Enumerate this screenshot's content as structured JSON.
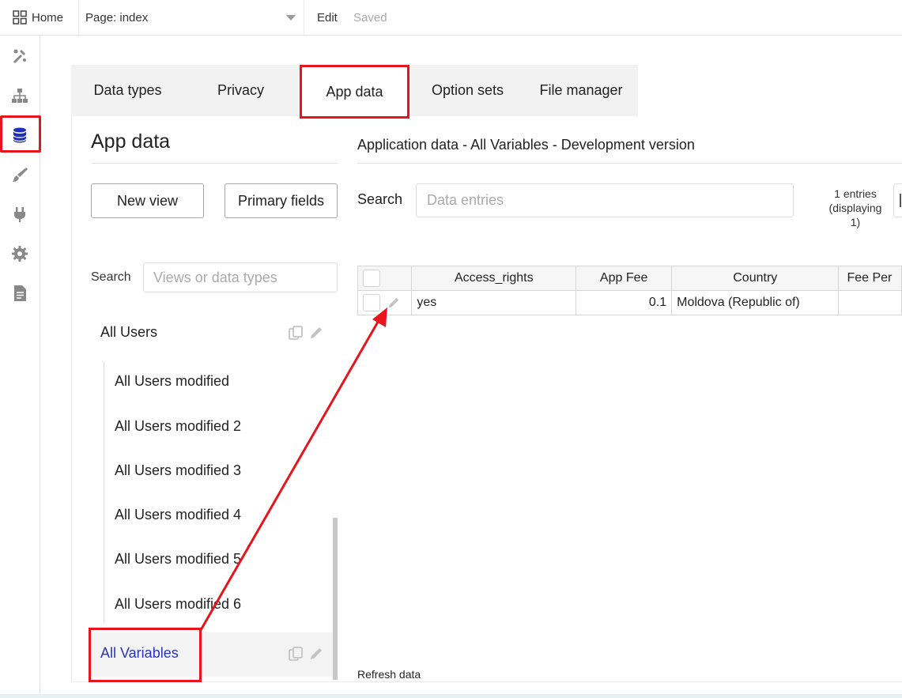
{
  "topbar": {
    "home_label": "Home",
    "page_select": "Page: index",
    "edit_label": "Edit",
    "saved_label": "Saved"
  },
  "rail": {
    "icons": [
      "design-icon",
      "workflow-icon",
      "data-icon",
      "styles-icon",
      "plugins-icon",
      "settings-icon",
      "logs-icon"
    ],
    "active": "data-icon",
    "active_color": "#1f2fb7"
  },
  "tabs": [
    {
      "label": "Data types"
    },
    {
      "label": "Privacy"
    },
    {
      "label": "App data"
    },
    {
      "label": "Option sets"
    },
    {
      "label": "File manager"
    }
  ],
  "left": {
    "title": "App data",
    "new_view": "New view",
    "primary_fields": "Primary fields",
    "search_label": "Search",
    "search_placeholder": "Views or data types",
    "views": [
      {
        "label": "All Users"
      },
      {
        "label": "All Users modified"
      },
      {
        "label": "All Users modified 2"
      },
      {
        "label": "All Users modified 3"
      },
      {
        "label": "All Users modified 4"
      },
      {
        "label": "All Users modified 5"
      },
      {
        "label": "All Users modified 6"
      },
      {
        "label": "All Variables"
      }
    ],
    "selected_color": "#2b35b8"
  },
  "right": {
    "title": "Application data - All Variables - Development version",
    "search_label": "Search",
    "search_placeholder": "Data entries",
    "entries_line1": "1 entries",
    "entries_line2": "(displaying",
    "entries_line3": "1)",
    "table": {
      "headers": [
        "Access_rights",
        "App Fee",
        "Country",
        "Fee Per"
      ],
      "rows": [
        {
          "access_rights": "yes",
          "app_fee": "0.1",
          "country": "Moldova (Republic of)",
          "fee_per": ""
        }
      ]
    },
    "refresh": "Refresh data"
  },
  "annotation_color": "#e8141b"
}
